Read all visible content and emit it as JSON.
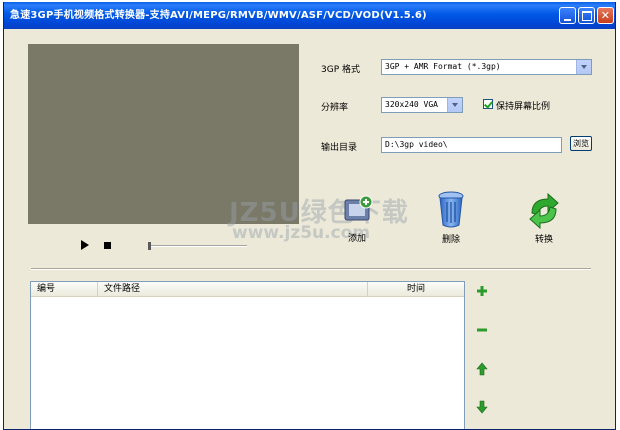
{
  "window": {
    "title": "急速3GP手机视频格式转换器-支持AVI/MEPG/RMVB/WMV/ASF/VCD/VOD(V1.5.6)",
    "min_glyph": "",
    "max_glyph": "",
    "close_glyph": "✕"
  },
  "player": {
    "play_label": "",
    "stop_label": "",
    "seek_progress": 0
  },
  "settings": {
    "format_label": "3GP 格式",
    "format_value": "3GP + AMR Format (*.3gp)",
    "resolution_label": "分辨率",
    "resolution_value": "320x240 VGA",
    "keep_ratio_label": "保持屏幕比例",
    "keep_ratio_checked": true,
    "output_label": "输出目录",
    "output_value": "D:\\3gp video\\",
    "browse_label": "浏览"
  },
  "toolbar": {
    "add_label": "添加",
    "delete_label": "删除",
    "convert_label": "转换"
  },
  "watermark": {
    "line1": "JZ5U绿色下载",
    "line2": "www.jz5u.com"
  },
  "file_list": {
    "columns": [
      "编号",
      "文件路径",
      "时间"
    ],
    "rows": []
  },
  "side_buttons": {
    "add": "+",
    "remove": "−",
    "up": "↑",
    "down": "↓"
  },
  "colors": {
    "title_bar": "#0054e3",
    "window_bg": "#ece9d8",
    "preview_bg": "#7a7866",
    "accent_green": "#2c9a2c"
  }
}
